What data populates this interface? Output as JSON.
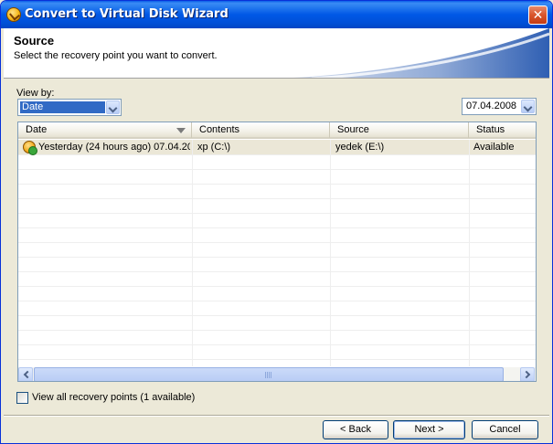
{
  "window": {
    "title": "Convert to Virtual Disk Wizard",
    "close_symbol": "✕"
  },
  "header": {
    "title": "Source",
    "subtitle": "Select the recovery point you want to convert."
  },
  "view_by": {
    "label": "View by:",
    "value": "Date"
  },
  "date_filter": {
    "value": "07.04.2008"
  },
  "list": {
    "columns": [
      "Date",
      "Contents",
      "Source",
      "Status"
    ],
    "rows": [
      {
        "date": "Yesterday (24 hours ago) 07.04.20...",
        "contents": "xp (C:\\)",
        "source": "yedek (E:\\)",
        "status": "Available"
      }
    ]
  },
  "view_all": {
    "label": "View all recovery points (1 available)",
    "checked": false
  },
  "buttons": {
    "back": "< Back",
    "next": "Next >",
    "cancel": "Cancel"
  },
  "colors": {
    "title_bar": "#0058e6",
    "selection": "#316ac5",
    "row_highlight": "#ebe7d7",
    "background": "#ece9d8"
  }
}
